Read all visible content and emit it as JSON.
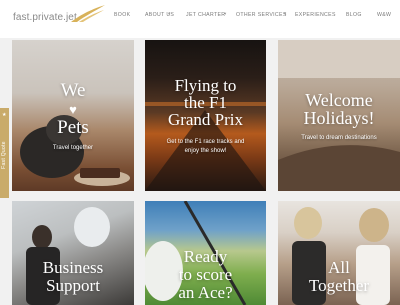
{
  "brand": {
    "name": "fast.private.jet"
  },
  "nav": {
    "book": "BOOK",
    "about": "ABOUT US",
    "jet_charter": "JET CHARTER",
    "other_services": "OTHER SERVICES",
    "experiences": "EXPERIENCES",
    "blog": "BLOG",
    "more": "W&W"
  },
  "side_tab": {
    "label": "Fast Quote"
  },
  "cards": [
    {
      "title_lines": [
        "We",
        "",
        "Pets"
      ],
      "subtitle_lines": [
        "Travel together"
      ]
    },
    {
      "title_lines": [
        "Flying to",
        "the F1",
        "Grand Prix"
      ],
      "subtitle_lines": [
        "Get to the F1 race tracks and",
        "enjoy the show!"
      ]
    },
    {
      "title_lines": [
        "Welcome",
        "Holidays!"
      ],
      "subtitle_lines": [
        "Travel to dream destinations"
      ]
    },
    {
      "title_lines": [
        "Business",
        "Support"
      ],
      "subtitle_lines": []
    },
    {
      "title_lines": [
        "Ready",
        "to score",
        "an Ace?"
      ],
      "subtitle_lines": []
    },
    {
      "title_lines": [
        "All",
        "Together"
      ],
      "subtitle_lines": []
    }
  ],
  "colors": {
    "accent": "#c9ab6a",
    "header_bg": "#ffffff",
    "page_bg": "#f1f1f1"
  },
  "icons": {
    "logo": "wing-logo-icon",
    "heart": "heart-icon",
    "dropdown": "chevron-down-icon"
  }
}
